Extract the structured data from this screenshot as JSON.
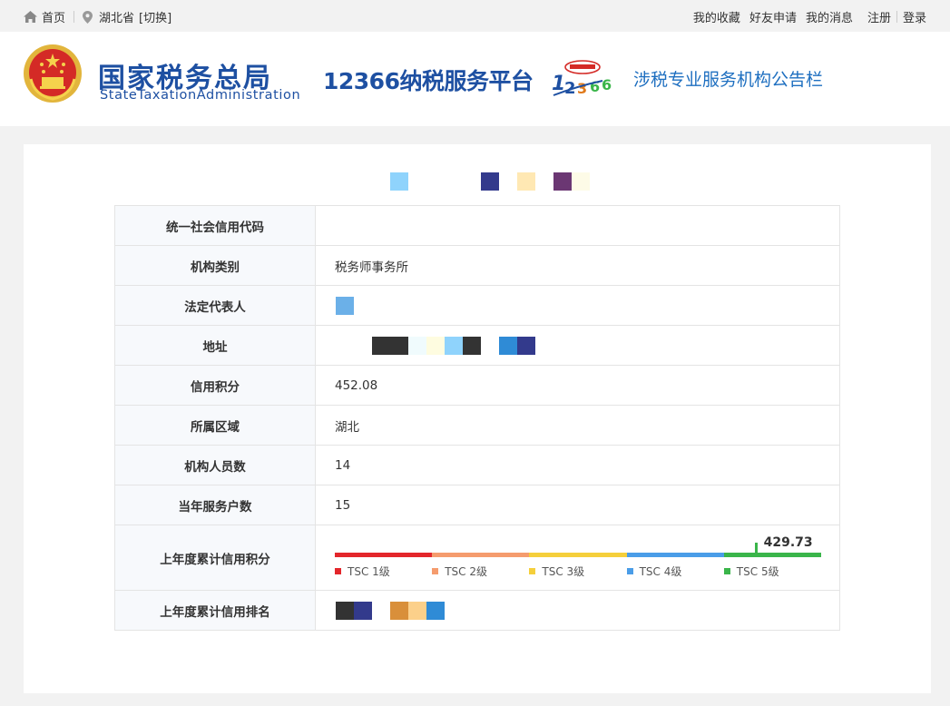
{
  "topbar": {
    "home": "首页",
    "location": "湖北省",
    "switch": "[切换]",
    "links": [
      "我的收藏",
      "好友申请",
      "我的消息"
    ],
    "register": "注册",
    "login": "登录"
  },
  "header": {
    "brand_cn": "国家税务总局",
    "brand_en": "StateTaxationAdministration",
    "platform": "12366纳税服务平台",
    "board_title": "涉税专业服务机构公告栏",
    "accent": "#1e50a2"
  },
  "rows": [
    {
      "label": "统一社会信用代码",
      "value": ""
    },
    {
      "label": "机构类别",
      "value": "税务师事务所"
    },
    {
      "label": "法定代表人",
      "value": ""
    },
    {
      "label": "地址",
      "value": ""
    },
    {
      "label": "信用积分",
      "value": "452.08"
    },
    {
      "label": "所属区域",
      "value": "湖北"
    },
    {
      "label": "机构人员数",
      "value": "14"
    },
    {
      "label": "当年服务户数",
      "value": "15"
    },
    {
      "label": "上年度累计信用积分",
      "value": ""
    },
    {
      "label": "上年度累计信用排名",
      "value": ""
    }
  ],
  "score": {
    "value": "429.73",
    "level_fraction": 0.865,
    "levels": [
      {
        "name": "TSC 1级",
        "color": "#e3262b"
      },
      {
        "name": "TSC 2级",
        "color": "#f59c6e"
      },
      {
        "name": "TSC 3级",
        "color": "#f5cf3b"
      },
      {
        "name": "TSC 4级",
        "color": "#4a9de8"
      },
      {
        "name": "TSC 5级",
        "color": "#3ab54a"
      }
    ]
  }
}
